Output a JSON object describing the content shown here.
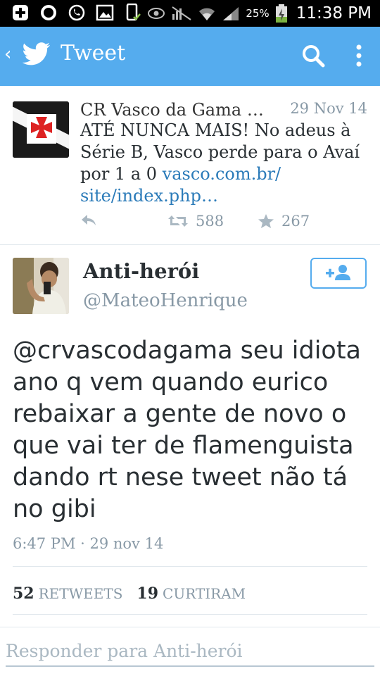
{
  "status_bar": {
    "battery_percent": "25%",
    "time": "11:38 PM",
    "icons": [
      "add-notification-icon",
      "circle-notification-icon",
      "whatsapp-icon",
      "image-icon",
      "phone-check-icon",
      "eye-icon",
      "no-signal-vibrate-icon",
      "wifi-icon",
      "cell-signal-icon",
      "battery-charging-icon"
    ]
  },
  "app_bar": {
    "back_glyph": "‹",
    "title": "Tweet",
    "background": "#55acee"
  },
  "context_tweet": {
    "author": "CR Vasco da Gama …",
    "date": "29 Nov 14",
    "text": "ATÉ NUNCA MAIS! No adeus à Série B, Vasco perde para o Avaí por 1 a 0 ",
    "link": "vasco.com.br/ site/index.php…",
    "retweets": "588",
    "favorites": "267"
  },
  "tweet": {
    "name": "Anti-herói",
    "handle": "@MateoHenrique",
    "text": "@crvascodagama seu idiota ano q vem quando eurico rebaixar a gente de novo o que vai ter de flamenguista dando rt nese tweet não tá no gibi",
    "timestamp": "6:47 PM · 29 nov 14",
    "retweet_count": "52",
    "retweet_label": "RETWEETS",
    "favorite_count": "19",
    "favorite_label": "CURTIRAM"
  },
  "reply": {
    "placeholder": "Responder para Anti-herói"
  },
  "colors": {
    "accent": "#55acee",
    "link": "#2b7bb9",
    "muted": "#8899a6",
    "text": "#292f33"
  }
}
